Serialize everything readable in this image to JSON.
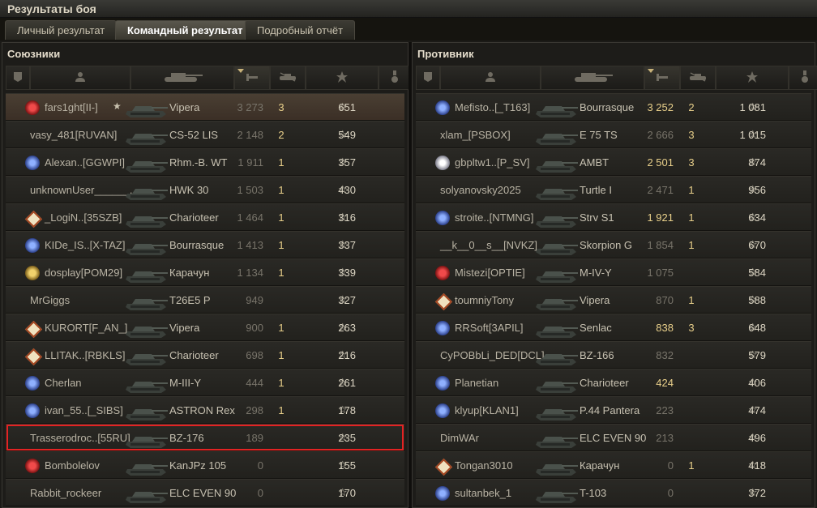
{
  "window": {
    "title": "Результаты боя"
  },
  "tabs": [
    {
      "label": "Личный результат",
      "active": false
    },
    {
      "label": "Командный результат",
      "active": true
    },
    {
      "label": "Подробный отчёт",
      "active": false
    }
  ],
  "allies": {
    "title": "Союзники",
    "rows": [
      {
        "name": "fars1ght[II-]",
        "badge": "red",
        "tank": "Vipera",
        "damage": "3 273",
        "damage_hi": false,
        "kills": "3",
        "xp": "651",
        "self": true,
        "platoon": true
      },
      {
        "name": "vasy_481[RUVAN]",
        "badge": "",
        "tank": "CS-52 LIS",
        "damage": "2 148",
        "damage_hi": false,
        "kills": "2",
        "xp": "549"
      },
      {
        "name": "Alexan..[GGWPI]",
        "badge": "blue",
        "tank": "Rhm.-B. WT",
        "damage": "1 911",
        "damage_hi": false,
        "kills": "1",
        "xp": "357"
      },
      {
        "name": "unknownUser______..",
        "badge": "",
        "tank": "HWK 30",
        "damage": "1 503",
        "damage_hi": false,
        "kills": "1",
        "xp": "430"
      },
      {
        "name": "_LogiN..[35SZB]",
        "badge": "diamond",
        "tank": "Charioteer",
        "damage": "1 464",
        "damage_hi": false,
        "kills": "1",
        "xp": "316"
      },
      {
        "name": "KIDe_IS..[X-TAZ]",
        "badge": "blue",
        "tank": "Bourrasque",
        "damage": "1 413",
        "damage_hi": false,
        "kills": "1",
        "xp": "337"
      },
      {
        "name": "dosplay[POM29]",
        "badge": "gold",
        "tank": "Карачун",
        "damage": "1 134",
        "damage_hi": false,
        "kills": "1",
        "xp": "339"
      },
      {
        "name": "MrGiggs",
        "badge": "",
        "tank": "T26E5 P",
        "damage": "949",
        "damage_hi": false,
        "kills": "",
        "xp": "327"
      },
      {
        "name": "KURORT[F_AN_]",
        "badge": "diamond",
        "tank": "Vipera",
        "damage": "900",
        "damage_hi": false,
        "kills": "1",
        "xp": "263"
      },
      {
        "name": "LLITAK..[RBKLS]",
        "badge": "diamond",
        "tank": "Charioteer",
        "damage": "698",
        "damage_hi": false,
        "kills": "1",
        "xp": "216"
      },
      {
        "name": "Cherlan",
        "badge": "blue",
        "tank": "M-III-Y",
        "damage": "444",
        "damage_hi": false,
        "kills": "1",
        "xp": "261"
      },
      {
        "name": "ivan_55..[_SIBS]",
        "badge": "blue",
        "tank": "ASTRON Rex",
        "damage": "298",
        "damage_hi": false,
        "kills": "1",
        "xp": "178"
      },
      {
        "name": "Trasserodroc..[55RU]",
        "badge": "",
        "tank": "BZ-176",
        "damage": "189",
        "damage_hi": false,
        "kills": "",
        "xp": "235",
        "highlight": true
      },
      {
        "name": "Bombolelov",
        "badge": "red",
        "tank": "KanJPz 105",
        "damage": "0",
        "damage_hi": false,
        "kills": "",
        "xp": "155"
      },
      {
        "name": "Rabbit_rockeer",
        "badge": "",
        "tank": "ELC EVEN 90",
        "damage": "0",
        "damage_hi": false,
        "kills": "",
        "xp": "170"
      }
    ]
  },
  "enemies": {
    "title": "Противник",
    "rows": [
      {
        "name": "Mefisto..[_T163]",
        "badge": "blue",
        "tank": "Bourrasque",
        "damage": "3 252",
        "damage_hi": true,
        "kills": "2",
        "xp": "1 081"
      },
      {
        "name": "xlam_[PSBOX]",
        "badge": "",
        "tank": "E 75 TS",
        "damage": "2 666",
        "damage_hi": false,
        "kills": "3",
        "xp": "1 015"
      },
      {
        "name": "gbpltw1..[P_SV]",
        "badge": "white",
        "tank": "AMBT",
        "damage": "2 501",
        "damage_hi": true,
        "kills": "3",
        "xp": "874"
      },
      {
        "name": "solyanovsky2025",
        "badge": "",
        "tank": "Turtle I",
        "damage": "2 471",
        "damage_hi": false,
        "kills": "1",
        "xp": "956"
      },
      {
        "name": "stroite..[NTMNG]",
        "badge": "blue",
        "tank": "Strv S1",
        "damage": "1 921",
        "damage_hi": true,
        "kills": "1",
        "xp": "634"
      },
      {
        "name": "__k__0__s__[NVKZ]",
        "badge": "",
        "tank": "Skorpion G",
        "damage": "1 854",
        "damage_hi": false,
        "kills": "1",
        "xp": "670"
      },
      {
        "name": "Mistezi[OPTIE]",
        "badge": "red",
        "tank": "M-IV-Y",
        "damage": "1 075",
        "damage_hi": false,
        "kills": "",
        "xp": "584"
      },
      {
        "name": "toumniyTony",
        "badge": "diamond",
        "tank": "Vipera",
        "damage": "870",
        "damage_hi": false,
        "kills": "1",
        "xp": "588"
      },
      {
        "name": "RRSoft[3APIL]",
        "badge": "blue",
        "tank": "Senlac",
        "damage": "838",
        "damage_hi": true,
        "kills": "3",
        "xp": "648"
      },
      {
        "name": "CyPOBbLi_DED[DCL]",
        "badge": "",
        "tank": "BZ-166",
        "damage": "832",
        "damage_hi": false,
        "kills": "",
        "xp": "579"
      },
      {
        "name": "Planetian",
        "badge": "blue",
        "tank": "Charioteer",
        "damage": "424",
        "damage_hi": true,
        "kills": "",
        "xp": "406"
      },
      {
        "name": "klyup[KLAN1]",
        "badge": "blue",
        "tank": "P.44 Pantera",
        "damage": "223",
        "damage_hi": false,
        "kills": "",
        "xp": "474"
      },
      {
        "name": "DimWAr",
        "badge": "",
        "tank": "ELC EVEN 90",
        "damage": "213",
        "damage_hi": false,
        "kills": "",
        "xp": "496"
      },
      {
        "name": "Tongan3010",
        "badge": "diamond",
        "tank": "Карачун",
        "damage": "0",
        "damage_hi": false,
        "kills": "1",
        "xp": "418"
      },
      {
        "name": "sultanbek_1",
        "badge": "blue",
        "tank": "T-103",
        "damage": "0",
        "damage_hi": false,
        "kills": "",
        "xp": "372"
      }
    ]
  },
  "columns": [
    {
      "icon": "tier-badge-icon"
    },
    {
      "icon": "player-icon"
    },
    {
      "icon": "tank-icon"
    },
    {
      "icon": "damage-icon"
    },
    {
      "icon": "kills-icon"
    },
    {
      "icon": "experience-star-icon"
    },
    {
      "icon": "medal-icon"
    }
  ],
  "colors": {
    "highlight": "#e32323",
    "accent": "#e8cf8a"
  }
}
